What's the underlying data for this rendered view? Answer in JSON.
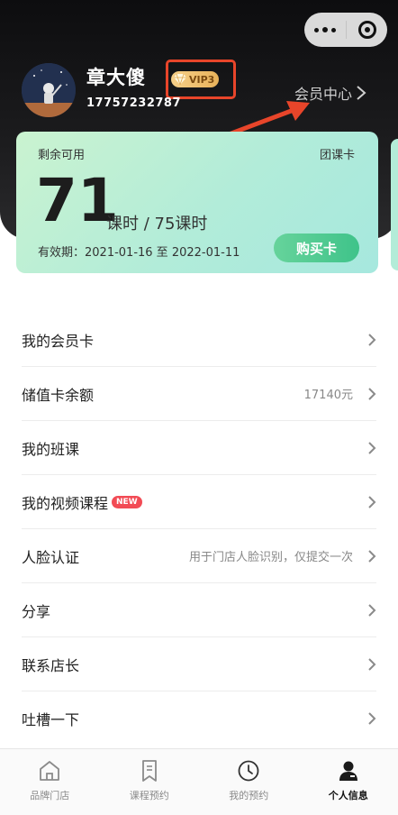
{
  "header": {
    "username": "章大傻",
    "vip_label": "VIP3",
    "phone": "17757232787",
    "member_center_label": "会员中心"
  },
  "card": {
    "remaining_label": "剩余可用",
    "card_type": "团课卡",
    "remaining_count": "71",
    "hours_text": "课时 / 75课时",
    "validity": "有效期：2021-01-16 至 2022-01-11",
    "buy_label": "购买卡"
  },
  "menu": {
    "items": [
      {
        "label": "我的会员卡",
        "value": ""
      },
      {
        "label": "储值卡余额",
        "value": "17140元"
      },
      {
        "label": "我的班课",
        "value": ""
      },
      {
        "label": "我的视频课程",
        "value": "",
        "badge": "NEW"
      },
      {
        "label": "人脸认证",
        "value": "用于门店人脸识别，仅提交一次"
      },
      {
        "label": "分享",
        "value": ""
      },
      {
        "label": "联系店长",
        "value": ""
      },
      {
        "label": "吐槽一下",
        "value": ""
      }
    ]
  },
  "tabbar": {
    "tabs": [
      {
        "label": "品牌门店",
        "icon": "home-icon"
      },
      {
        "label": "课程预约",
        "icon": "bookmark-icon"
      },
      {
        "label": "我的预约",
        "icon": "clock-icon"
      },
      {
        "label": "个人信息",
        "icon": "user-icon",
        "active": true
      }
    ]
  },
  "colors": {
    "header_bg": "#1c1c1e",
    "card_gradient_start": "#caf3d0",
    "card_gradient_end": "#a6e8de",
    "buy_button": "#3fc38a",
    "vip_badge": "#e8b25a",
    "annotation_red": "#e8452a",
    "new_badge": "#f24b55"
  }
}
